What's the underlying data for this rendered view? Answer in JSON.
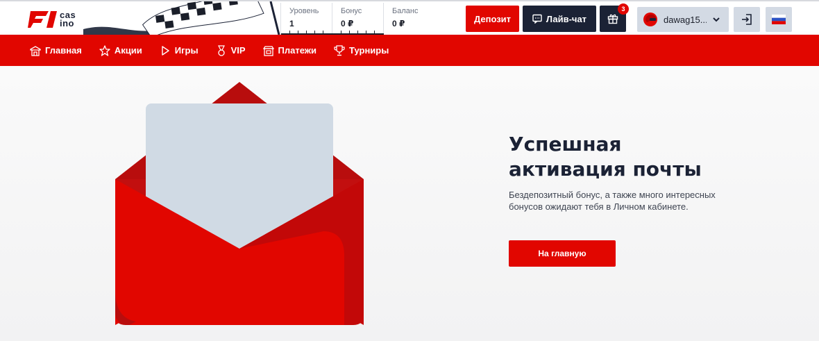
{
  "logo": {
    "text_line1": "cas",
    "text_line2": "ino"
  },
  "stats": [
    {
      "label": "Уровень",
      "value": "1"
    },
    {
      "label": "Бонус",
      "value": "0 ₽"
    },
    {
      "label": "Баланс",
      "value": "0 ₽"
    }
  ],
  "header": {
    "deposit_label": "Депозит",
    "chat_label": "Лайв-чат",
    "gift_count": "3",
    "username": "dawag15...",
    "language_icon": "russia-flag-icon"
  },
  "nav": {
    "items": [
      {
        "label": "Главная",
        "icon": "home-icon"
      },
      {
        "label": "Акции",
        "icon": "star-icon"
      },
      {
        "label": "Игры",
        "icon": "play-icon"
      },
      {
        "label": "VIP",
        "icon": "vip-award-icon"
      },
      {
        "label": "Платежи",
        "icon": "payments-icon"
      },
      {
        "label": "Турниры",
        "icon": "trophy-icon"
      }
    ]
  },
  "main": {
    "title_line1": "Успешная",
    "title_line2": "активация почты",
    "description": "Бездепозитный бонус, а также много интересных бонусов ожидают тебя в Личном кабинете.",
    "home_button_label": "На главную"
  },
  "colors": {
    "brand_red": "#e10600",
    "dark_navy": "#1b2235",
    "light_gray_button": "#d3dae4"
  }
}
